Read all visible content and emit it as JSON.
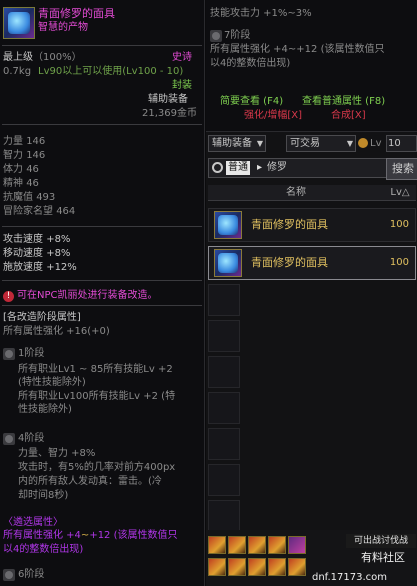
{
  "item": {
    "name": "青面修罗的面具",
    "subtitle": "智慧的产物",
    "grade_label": "最上级",
    "grade_pct": "（100%）",
    "rarity": "史诗",
    "weight": "0.7kg",
    "level_req": "Lv90以上可以使用(Lv100 - 10)",
    "sealed": "封装",
    "type": "辅助装备",
    "price": "21,369金币",
    "stats": [
      {
        "label": "力量",
        "value": "146"
      },
      {
        "label": "智力",
        "value": "146"
      },
      {
        "label": "体力",
        "value": "46"
      },
      {
        "label": "精神",
        "value": "46"
      },
      {
        "label": "抗魔值",
        "value": "493"
      },
      {
        "label": "冒险家名望",
        "value": "464"
      }
    ],
    "speeds": [
      {
        "label": "攻击速度",
        "value": "+8%"
      },
      {
        "label": "移动速度",
        "value": "+8%"
      },
      {
        "label": "施放速度",
        "value": "+12%"
      }
    ],
    "notice": "可在NPC凯丽处进行装备改造。",
    "upgrade_header": "[各改造阶段属性]",
    "upgrade_all": "所有属性强化 +16(+0)",
    "stage1_title": "1阶段",
    "stage1_lines": [
      "所有职业Lv1 ~ 85所有技能Lv +2",
      "(特性技能除外)",
      "所有职业Lv100所有技能Lv +2 (特",
      "性技能除外)"
    ],
    "stage4_title": "4阶段",
    "stage4_lines": [
      "力量、智力 +8%",
      "攻击时，有5%的几率对前方400px",
      "内的所有敌人发动真：雷击。(冷",
      "却时间8秒)"
    ],
    "trans_header": "〈遴选属性〉",
    "trans_line1a": "所有属性强化 +4",
    "trans_line1b": "+12 (该属性数值只",
    "trans_line2": "以4的整数倍出现)",
    "stage6_title": "6阶段"
  },
  "tooltip2": {
    "line1": "技能攻击力 +1%~3%",
    "stage7": "7阶段",
    "line2": "所有属性强化 +4~+12 (该属性数值只",
    "line3": "以4的整数倍出现)",
    "link_brief": "简要查看 (F4)",
    "link_normal": "查看普通属性 (F8)",
    "link_amp": "强化/增幅[X]",
    "link_synth": "合成[X]"
  },
  "auction": {
    "filter_category": "辅助装备",
    "filter_trade": "可交易",
    "filter_lv_label": "Lv",
    "filter_lv_value": "10",
    "search_mode": "普通",
    "search_query": "修罗",
    "search_button": "搜索",
    "col_name": "名称",
    "col_lv": "Lv△",
    "rows": [
      {
        "name": "青面修罗的面具",
        "lv": "100"
      },
      {
        "name": "青面修罗的面具",
        "lv": "100"
      }
    ]
  },
  "watermark": {
    "community": "有料社区",
    "site": "dnf.17173.com",
    "banner": "可出战讨伐战"
  }
}
